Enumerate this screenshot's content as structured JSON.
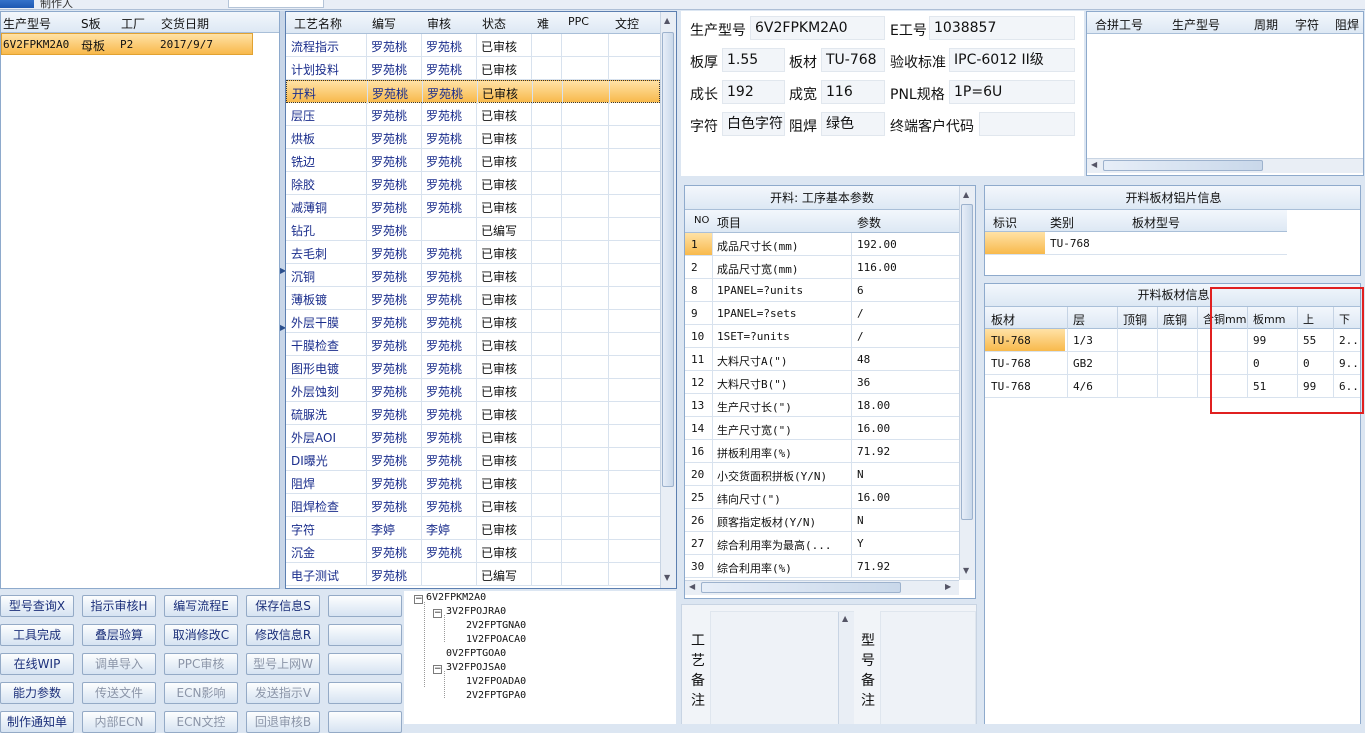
{
  "top": {
    "partial_title": "制作人",
    "partial_field": ""
  },
  "orders": {
    "headers": [
      "生产型号",
      "S板",
      "工厂",
      "交货日期"
    ],
    "rows": [
      {
        "model": "6V2FPKM2A0",
        "sboard": "母板",
        "factory": "P2",
        "date": "2017/9/7"
      }
    ]
  },
  "process": {
    "headers": [
      "工艺名称",
      "编写",
      "审核",
      "状态",
      "难",
      "PPC",
      "文控"
    ],
    "rows": [
      {
        "name": "流程指示",
        "writer": "罗苑桃",
        "checker": "罗苑桃",
        "status": "已审核"
      },
      {
        "name": "计划投料",
        "writer": "罗苑桃",
        "checker": "罗苑桃",
        "status": "已审核"
      },
      {
        "name": "开料",
        "writer": "罗苑桃",
        "checker": "罗苑桃",
        "status": "已审核"
      },
      {
        "name": "层压",
        "writer": "罗苑桃",
        "checker": "罗苑桃",
        "status": "已审核"
      },
      {
        "name": "烘板",
        "writer": "罗苑桃",
        "checker": "罗苑桃",
        "status": "已审核"
      },
      {
        "name": "铣边",
        "writer": "罗苑桃",
        "checker": "罗苑桃",
        "status": "已审核"
      },
      {
        "name": "除胶",
        "writer": "罗苑桃",
        "checker": "罗苑桃",
        "status": "已审核"
      },
      {
        "name": "减薄铜",
        "writer": "罗苑桃",
        "checker": "罗苑桃",
        "status": "已审核"
      },
      {
        "name": "钻孔",
        "writer": "罗苑桃",
        "checker": "",
        "status": "已编写"
      },
      {
        "name": "去毛刺",
        "writer": "罗苑桃",
        "checker": "罗苑桃",
        "status": "已审核"
      },
      {
        "name": "沉铜",
        "writer": "罗苑桃",
        "checker": "罗苑桃",
        "status": "已审核"
      },
      {
        "name": "薄板镀",
        "writer": "罗苑桃",
        "checker": "罗苑桃",
        "status": "已审核"
      },
      {
        "name": "外层干膜",
        "writer": "罗苑桃",
        "checker": "罗苑桃",
        "status": "已审核"
      },
      {
        "name": "干膜检查",
        "writer": "罗苑桃",
        "checker": "罗苑桃",
        "status": "已审核"
      },
      {
        "name": "图形电镀",
        "writer": "罗苑桃",
        "checker": "罗苑桃",
        "status": "已审核"
      },
      {
        "name": "外层蚀刻",
        "writer": "罗苑桃",
        "checker": "罗苑桃",
        "status": "已审核"
      },
      {
        "name": "硫脲洗",
        "writer": "罗苑桃",
        "checker": "罗苑桃",
        "status": "已审核"
      },
      {
        "name": "外层AOI",
        "writer": "罗苑桃",
        "checker": "罗苑桃",
        "status": "已审核"
      },
      {
        "name": "DI曝光",
        "writer": "罗苑桃",
        "checker": "罗苑桃",
        "status": "已审核"
      },
      {
        "name": "阻焊",
        "writer": "罗苑桃",
        "checker": "罗苑桃",
        "status": "已审核"
      },
      {
        "name": "阻焊检查",
        "writer": "罗苑桃",
        "checker": "罗苑桃",
        "status": "已审核"
      },
      {
        "name": "字符",
        "writer": "李婷",
        "checker": "李婷",
        "status": "已审核"
      },
      {
        "name": "沉金",
        "writer": "罗苑桃",
        "checker": "罗苑桃",
        "status": "已审核"
      },
      {
        "name": "电子测试",
        "writer": "罗苑桃",
        "checker": "",
        "status": "已编写"
      }
    ]
  },
  "buttons": [
    [
      "型号查询X",
      "指示审核H",
      "编写流程E",
      "保存信息S",
      ""
    ],
    [
      "工具完成",
      "叠层验算",
      "取消修改C",
      "修改信息R",
      ""
    ],
    [
      "在线WIP",
      "调单导入",
      "PPC审核",
      "型号上网W",
      ""
    ],
    [
      "能力参数",
      "传送文件",
      "ECN影响",
      "发送指示V",
      ""
    ],
    [
      "制作通知单",
      "内部ECN",
      "ECN文控",
      "回退审核B",
      ""
    ]
  ],
  "tree": {
    "root": "6V2FPKM2A0",
    "n1": "3V2FPOJRA0",
    "n1a": "2V2FPTGNA0",
    "n1b": "1V2FPOACA0",
    "n2": "0V2FPTGOA0",
    "n3": "3V2FPOJSA0",
    "n3a": "1V2FPOADA0",
    "n3b": "2V2FPTGPA0"
  },
  "info": {
    "model_label": "生产型号",
    "model": "6V2FPKM2A0",
    "e_label": "E工号",
    "e_no": "1038857",
    "thick_label": "板厚",
    "thick": "1.55",
    "mat_label": "板材",
    "mat": "TU-768",
    "std_label": "验收标准",
    "std": "IPC-6012 II级",
    "len_label": "成长",
    "len": "192",
    "wid_label": "成宽",
    "wid": "116",
    "pnl_label": "PNL规格",
    "pnl": "1P=6U",
    "char_label": "字符",
    "char": "白色字符",
    "mask_label": "阻焊",
    "mask": "绿色",
    "cust_label": "终端客户代码",
    "cust": ""
  },
  "merge": {
    "headers": [
      "合拼工号",
      "生产型号",
      "周期",
      "字符",
      "阻焊"
    ]
  },
  "params": {
    "title": "开料: 工序基本参数",
    "headers": [
      "NO",
      "项目",
      "参数"
    ],
    "rows": [
      {
        "no": "1",
        "item": "成品尺寸长(mm)",
        "value": "192.00"
      },
      {
        "no": "2",
        "item": "成品尺寸宽(mm)",
        "value": "116.00"
      },
      {
        "no": "8",
        "item": "1PANEL=?units",
        "value": "6"
      },
      {
        "no": "9",
        "item": "1PANEL=?sets",
        "value": "/"
      },
      {
        "no": "10",
        "item": "1SET=?units",
        "value": "/"
      },
      {
        "no": "11",
        "item": "大料尺寸A(\")",
        "value": "48"
      },
      {
        "no": "12",
        "item": "大料尺寸B(\")",
        "value": "36"
      },
      {
        "no": "13",
        "item": "生产尺寸长(\")",
        "value": "18.00"
      },
      {
        "no": "14",
        "item": "生产尺寸宽(\")",
        "value": "16.00"
      },
      {
        "no": "16",
        "item": "拼板利用率(%)",
        "value": "71.92"
      },
      {
        "no": "20",
        "item": "小交货面积拼板(Y/N)",
        "value": "N"
      },
      {
        "no": "25",
        "item": "纬向尺寸(\")",
        "value": "16.00"
      },
      {
        "no": "26",
        "item": "顾客指定板材(Y/N)",
        "value": "N"
      },
      {
        "no": "27",
        "item": "综合利用率为最高(...",
        "value": "Y"
      },
      {
        "no": "30",
        "item": "综合利用率(%)",
        "value": "71.92"
      }
    ]
  },
  "alu": {
    "title": "开料板材铝片信息",
    "headers": [
      "标识",
      "类别",
      "板材型号"
    ],
    "rows": [
      {
        "mark": "",
        "cat": "TU-768",
        "model": ""
      }
    ]
  },
  "board": {
    "title": "开料板材信息",
    "headers": [
      "板材",
      "层",
      "顶铜",
      "底铜",
      "含铜mm",
      "板mm",
      "上",
      "下"
    ],
    "rows": [
      {
        "mat": "TU-768",
        "layer": "1/3",
        "top": "",
        "bottom": "",
        "cu": "",
        "mm": "99",
        "up": "55",
        "down": "2..."
      },
      {
        "mat": "TU-768",
        "layer": "GB2",
        "top": "",
        "bottom": "",
        "cu": "",
        "mm": "0",
        "up": "0",
        "down": "9..."
      },
      {
        "mat": "TU-768",
        "layer": "4/6",
        "top": "",
        "bottom": "",
        "cu": "",
        "mm": "51",
        "up": "99",
        "down": "6..."
      }
    ]
  },
  "notes": {
    "process_label": "工艺备注",
    "model_label": "型号备注"
  },
  "colors": {
    "selected": "#f8b94c",
    "highlight_box": "#e02020",
    "header": "#dde8f4"
  },
  "icons": {
    "arrow_up": "▲",
    "arrow_down": "▼",
    "arrow_left": "◀",
    "arrow_right": "▶",
    "collapse": "−"
  }
}
